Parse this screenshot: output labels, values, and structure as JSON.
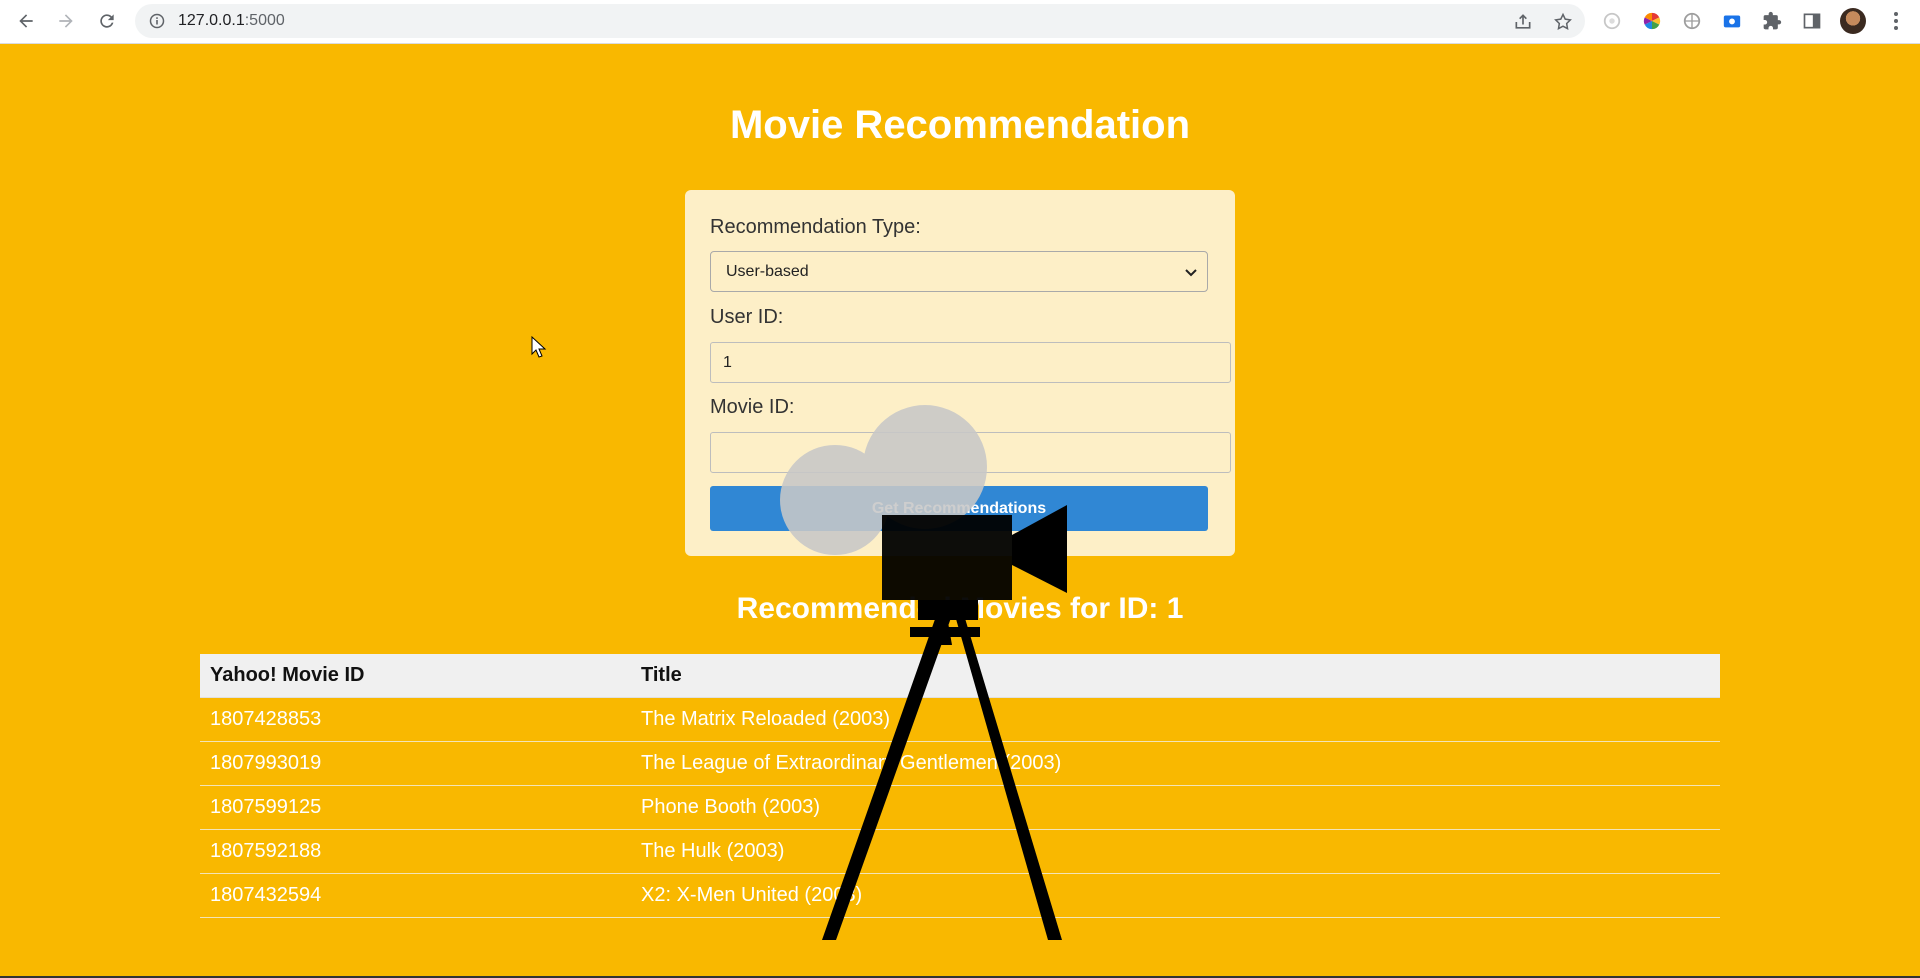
{
  "browser": {
    "url_host": "127.0.0.1",
    "url_port": ":5000"
  },
  "page": {
    "title": "Movie Recommendation"
  },
  "form": {
    "type_label": "Recommendation Type:",
    "type_selected": "User-based",
    "user_id_label": "User ID:",
    "user_id_value": "1",
    "movie_id_label": "Movie ID:",
    "movie_id_value": "",
    "submit_label": "Get Recommendations"
  },
  "results": {
    "heading": "Recommended Movies for ID: 1",
    "columns": [
      "Yahoo! Movie ID",
      "Title"
    ],
    "rows": [
      {
        "id": "1807428853",
        "title": "The Matrix Reloaded (2003)"
      },
      {
        "id": "1807993019",
        "title": "The League of Extraordinary Gentlemen (2003)"
      },
      {
        "id": "1807599125",
        "title": "Phone Booth (2003)"
      },
      {
        "id": "1807592188",
        "title": "The Hulk (2003)"
      },
      {
        "id": "1807432594",
        "title": "X2: X-Men United (2003)"
      }
    ]
  },
  "colors": {
    "background": "#f9b800",
    "card": "#fdefc7",
    "button": "#3087d4"
  },
  "icons": [
    "back-arrow-icon",
    "forward-arrow-icon",
    "reload-icon",
    "info-icon",
    "share-icon",
    "star-icon",
    "extension-icon",
    "puzzle-icon",
    "sidebar-icon",
    "menu-icon",
    "movie-camera-icon"
  ]
}
